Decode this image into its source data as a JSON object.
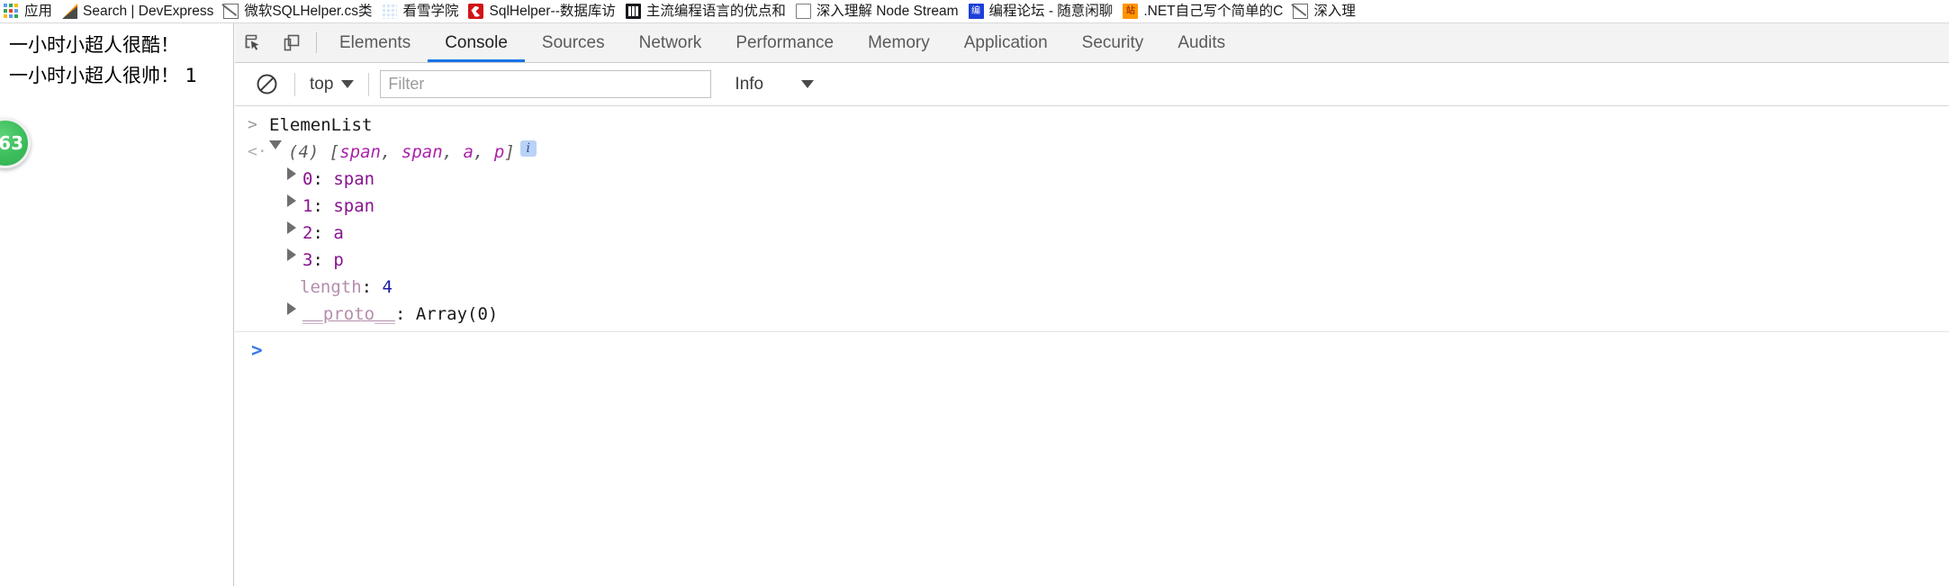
{
  "bookmark_bar": {
    "items": [
      {
        "label": "应用",
        "icon": "apps-grid-icon",
        "icon_class": "ico-apps",
        "glyph": ""
      },
      {
        "label": "Search | DevExpress",
        "icon": "devexpress-icon",
        "icon_class": "ico-devexpress",
        "glyph": ""
      },
      {
        "label": "微软SQLHelper.cs类",
        "icon": "cut-link-icon",
        "icon_class": "ico-cut",
        "glyph": ""
      },
      {
        "label": "看雪学院",
        "icon": "snowflake-icon",
        "icon_class": "ico-snow",
        "glyph": ""
      },
      {
        "label": "SqlHelper--数据库访",
        "icon": "red-site-icon",
        "icon_class": "ico-red",
        "glyph": ""
      },
      {
        "label": "主流编程语言的优点和",
        "icon": "dark-bars-icon",
        "icon_class": "ico-dark-bars",
        "glyph": ""
      },
      {
        "label": "深入理解 Node Stream",
        "icon": "document-icon",
        "icon_class": "ico-file-line",
        "glyph": ""
      },
      {
        "label": "编程论坛 - 随意闲聊",
        "icon": "forum-icon",
        "icon_class": "ico-blue-cn",
        "glyph": "编"
      },
      {
        "label": ".NET自己写个简单的C",
        "icon": "site-icon",
        "icon_class": "ico-orange-cn",
        "glyph": "站"
      },
      {
        "label": "深入理",
        "icon": "cut-link-icon",
        "icon_class": "ico-cut",
        "glyph": ""
      }
    ]
  },
  "page": {
    "line1": "一小时小超人很酷！",
    "line2": "一小时小超人很帅！ 1",
    "badge_value": "63"
  },
  "devtools": {
    "icons": {
      "inspect": "inspect-element-icon",
      "device": "device-toolbar-icon"
    },
    "tabs": [
      {
        "label": "Elements",
        "active": false
      },
      {
        "label": "Console",
        "active": true
      },
      {
        "label": "Sources",
        "active": false
      },
      {
        "label": "Network",
        "active": false
      },
      {
        "label": "Performance",
        "active": false
      },
      {
        "label": "Memory",
        "active": false
      },
      {
        "label": "Application",
        "active": false
      },
      {
        "label": "Security",
        "active": false
      },
      {
        "label": "Audits",
        "active": false
      }
    ],
    "toolbar": {
      "clear_icon": "clear-console-icon",
      "context": "top",
      "filter_placeholder": "Filter",
      "filter_value": "",
      "level": "Info"
    },
    "console": {
      "rows": [
        {
          "gutter": ">",
          "gutter_kind": "input",
          "indent": 0,
          "triangle": "none",
          "parts": [
            {
              "text": "ElemenList",
              "cls": "txt-plain"
            }
          ]
        },
        {
          "gutter": "<·",
          "gutter_kind": "output",
          "indent": 0,
          "triangle": "open",
          "parts": [
            {
              "text": "(4) ",
              "cls": "txt-count"
            },
            {
              "text": "[",
              "cls": "txt-count"
            },
            {
              "text": "span",
              "cls": "txt-node"
            },
            {
              "text": ", ",
              "cls": "txt-count"
            },
            {
              "text": "span",
              "cls": "txt-node"
            },
            {
              "text": ", ",
              "cls": "txt-count"
            },
            {
              "text": "a",
              "cls": "txt-node"
            },
            {
              "text": ", ",
              "cls": "txt-count"
            },
            {
              "text": "p",
              "cls": "txt-node"
            },
            {
              "text": "]",
              "cls": "txt-count"
            }
          ],
          "badge": "i"
        },
        {
          "gutter": "",
          "gutter_kind": "none",
          "indent": 1,
          "triangle": "closed",
          "parts": [
            {
              "text": "0",
              "cls": "txt-key"
            },
            {
              "text": ": ",
              "cls": "txt-val"
            },
            {
              "text": "span",
              "cls": "txt-key"
            }
          ]
        },
        {
          "gutter": "",
          "gutter_kind": "none",
          "indent": 1,
          "triangle": "closed",
          "parts": [
            {
              "text": "1",
              "cls": "txt-key"
            },
            {
              "text": ": ",
              "cls": "txt-val"
            },
            {
              "text": "span",
              "cls": "txt-key"
            }
          ]
        },
        {
          "gutter": "",
          "gutter_kind": "none",
          "indent": 1,
          "triangle": "closed",
          "parts": [
            {
              "text": "2",
              "cls": "txt-key"
            },
            {
              "text": ": ",
              "cls": "txt-val"
            },
            {
              "text": "a",
              "cls": "txt-key"
            }
          ]
        },
        {
          "gutter": "",
          "gutter_kind": "none",
          "indent": 1,
          "triangle": "closed",
          "parts": [
            {
              "text": "3",
              "cls": "txt-key"
            },
            {
              "text": ": ",
              "cls": "txt-val"
            },
            {
              "text": "p",
              "cls": "txt-key"
            }
          ]
        },
        {
          "gutter": "",
          "gutter_kind": "none",
          "indent": 2,
          "triangle": "none",
          "parts": [
            {
              "text": "length",
              "cls": "txt-dim"
            },
            {
              "text": ": ",
              "cls": "txt-val"
            },
            {
              "text": "4",
              "cls": "txt-num"
            }
          ]
        },
        {
          "gutter": "",
          "gutter_kind": "none",
          "indent": 1,
          "triangle": "closed",
          "parts": [
            {
              "text": "__proto__",
              "cls": "txt-proto"
            },
            {
              "text": ": ",
              "cls": "txt-val"
            },
            {
              "text": "Array(0)",
              "cls": "txt-val"
            }
          ]
        }
      ],
      "prompt": ">"
    }
  },
  "colors": {
    "accent": "#1a73e8",
    "badge_green": "#3fc05e",
    "node_purple": "#aa22aa",
    "key_purple": "#881391",
    "number_blue": "#1a1aa6",
    "info_badge_bg": "#b9d2f7"
  }
}
